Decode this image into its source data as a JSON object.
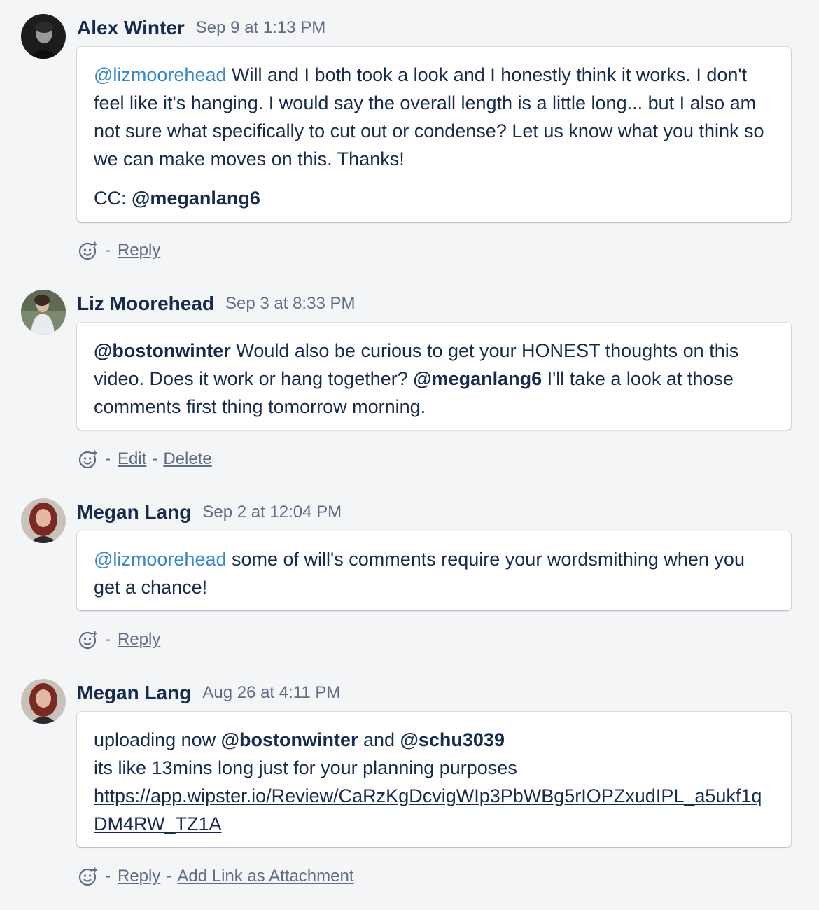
{
  "comments": [
    {
      "author": "Alex Winter",
      "time": "Sep 9 at 1:13 PM",
      "avatar_icon": "user-photo-icon",
      "body": {
        "mention": "@lizmoorehead",
        "text": " Will and I both took a look and I honestly think it works. I don't feel like it's hanging. I would say the overall length is a little long... but I also am not sure what specifically to cut out or condense? Let us know what you think so we can make moves on this. Thanks!",
        "cc_prefix": "CC: ",
        "cc_mention": "@meganlang6"
      },
      "actions": {
        "separator": "-",
        "reply": "Reply"
      }
    },
    {
      "author": "Liz Moorehead",
      "time": "Sep 3 at 8:33 PM",
      "avatar_icon": "user-photo-icon",
      "body": {
        "mention1": "@bostonwinter",
        "text1": " Would also be curious to get your HONEST thoughts on this video. Does it work or hang together? ",
        "mention2": "@meganlang6",
        "text2": " I'll take a look at those comments first thing tomorrow morning."
      },
      "actions": {
        "separator": "-",
        "edit": "Edit",
        "delete": "Delete"
      }
    },
    {
      "author": "Megan Lang",
      "time": "Sep 2 at 12:04 PM",
      "avatar_icon": "user-photo-icon",
      "body": {
        "mention": "@lizmoorehead",
        "text": " some of will's comments require your wordsmithing when you get a chance!"
      },
      "actions": {
        "separator": "-",
        "reply": "Reply"
      }
    },
    {
      "author": "Megan Lang",
      "time": "Aug 26 at 4:11 PM",
      "avatar_icon": "user-photo-icon",
      "body": {
        "text1": "uploading now ",
        "mention1": "@bostonwinter",
        "text2": " and ",
        "mention2": "@schu3039",
        "line2": "its like 13mins long just for your planning purposes",
        "url": "https://app.wipster.io/Review/CaRzKgDcvigWIp3PbWBg5rIOPZxudIPL_a5ukf1qDM4RW_TZ1A"
      },
      "actions": {
        "separator": "-",
        "reply": "Reply",
        "add_link": "Add Link as Attachment"
      }
    }
  ],
  "colors": {
    "background": "#f4f5f7",
    "text": "#172b4d",
    "muted": "#5e6c84",
    "link_mention": "#3a87c7",
    "card": "#ffffff"
  },
  "icons": [
    "add-reaction-icon"
  ]
}
